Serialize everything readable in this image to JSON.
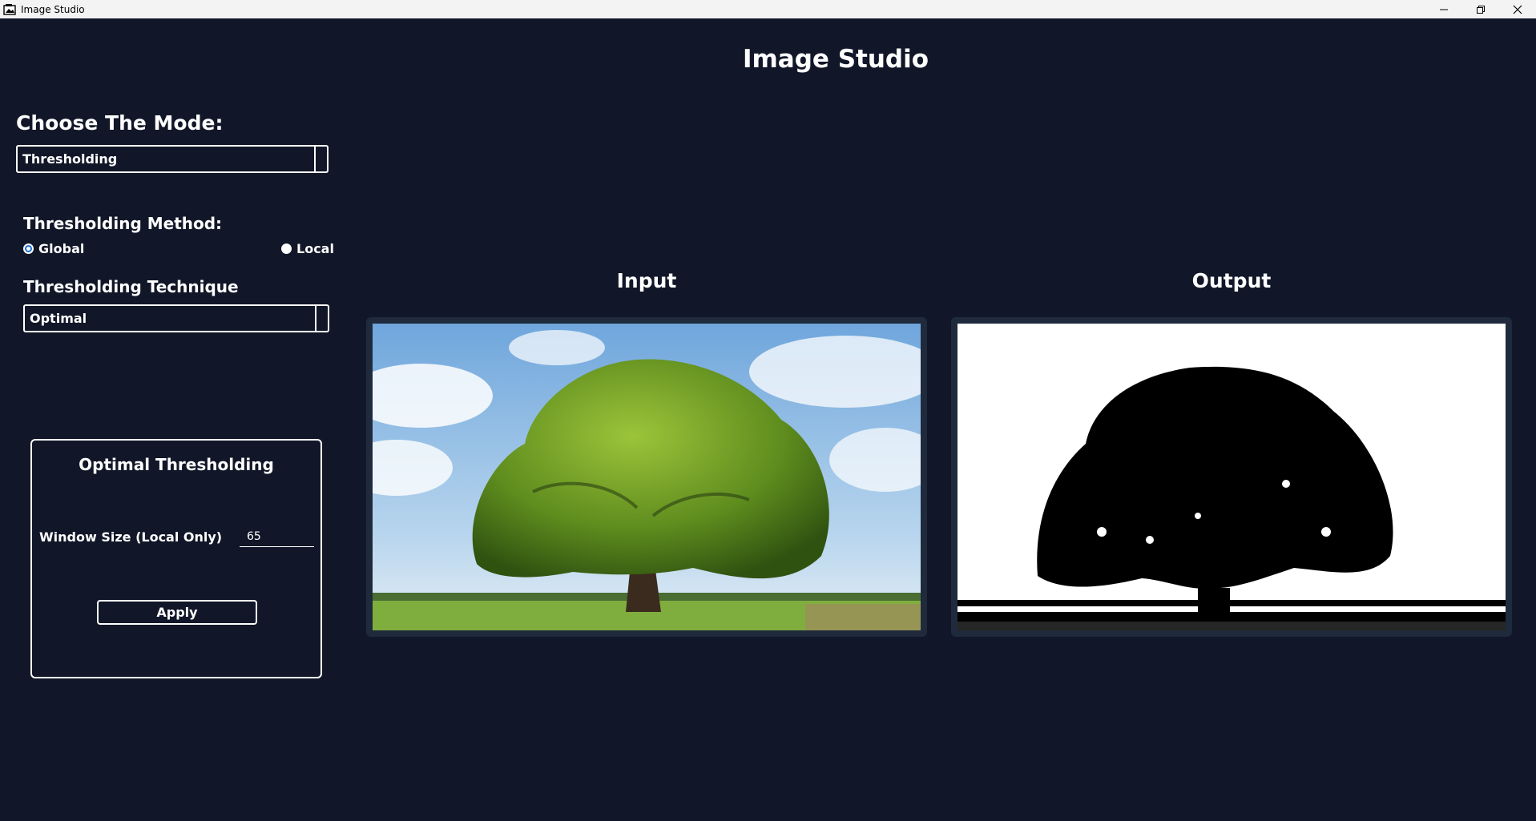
{
  "window": {
    "title": "Image Studio",
    "controls": [
      "minimize",
      "restore",
      "close"
    ]
  },
  "app_title": "Image Studio",
  "mode": {
    "label": "Choose The Mode:",
    "selected": "Thresholding"
  },
  "method": {
    "label": "Thresholding Method:",
    "options": [
      {
        "label": "Global",
        "checked": true
      },
      {
        "label": "Local",
        "checked": false
      }
    ]
  },
  "technique": {
    "label": "Thresholding Technique",
    "selected": "Optimal"
  },
  "panel": {
    "title": "Optimal Thresholding",
    "window_size_label": "Window Size (Local Only)",
    "window_size_value": "65",
    "apply_label": "Apply"
  },
  "images": {
    "input_label": "Input",
    "output_label": "Output"
  },
  "colors": {
    "background": "#111728",
    "frame": "#1f2a3c",
    "radio_checked": "#1d6fd6",
    "text": "#ffffff"
  }
}
